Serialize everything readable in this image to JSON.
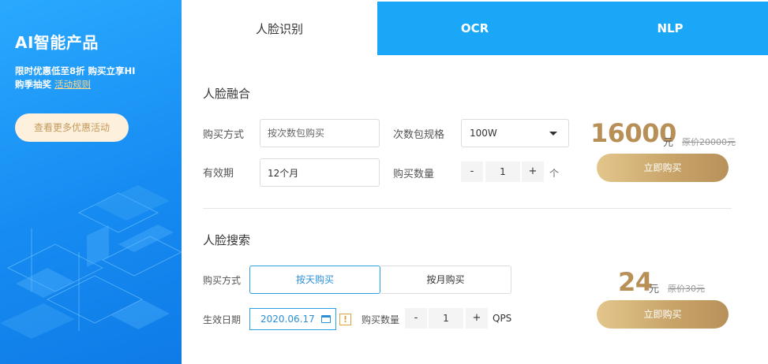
{
  "promo": {
    "title": "AI智能产品",
    "desc_line1": "限时优惠低至8折 购买立享HI",
    "desc_line2_prefix": "购季抽奖 ",
    "rules_link": "活动规则",
    "more_button": "查看更多优惠活动"
  },
  "tabs": [
    {
      "label": "人脸识别",
      "active": true
    },
    {
      "label": "OCR",
      "active": false
    },
    {
      "label": "NLP",
      "active": false
    }
  ],
  "face_fusion": {
    "title": "人脸融合",
    "purchase_mode_label": "购买方式",
    "purchase_mode_placeholder": "按次数包购买",
    "package_spec_label": "次数包规格",
    "package_spec_value": "100W",
    "validity_label": "有效期",
    "validity_value": "12个月",
    "quantity_label": "购买数量",
    "quantity_minus": "-",
    "quantity_value": "1",
    "quantity_plus": "+",
    "quantity_unit": "个",
    "price": "16000",
    "price_unit": "元",
    "original_price": "原价20000元",
    "buy_button": "立即购买"
  },
  "face_search": {
    "title": "人脸搜索",
    "purchase_mode_label": "购买方式",
    "mode_options": [
      {
        "label": "按天购买",
        "selected": true
      },
      {
        "label": "按月购买",
        "selected": false
      }
    ],
    "effective_date_label": "生效日期",
    "effective_date_value": "2020.06.17",
    "warning_glyph": "!",
    "quantity_label": "购买数量",
    "quantity_minus": "-",
    "quantity_value": "1",
    "quantity_plus": "+",
    "quantity_unit": "QPS",
    "price": "24",
    "price_unit": "元",
    "original_price": "原价30元",
    "buy_button": "立即购买"
  },
  "colors": {
    "tab_blue": "#1aa7f7",
    "gold": "#b88f57",
    "select_blue": "#2a8fd8"
  }
}
